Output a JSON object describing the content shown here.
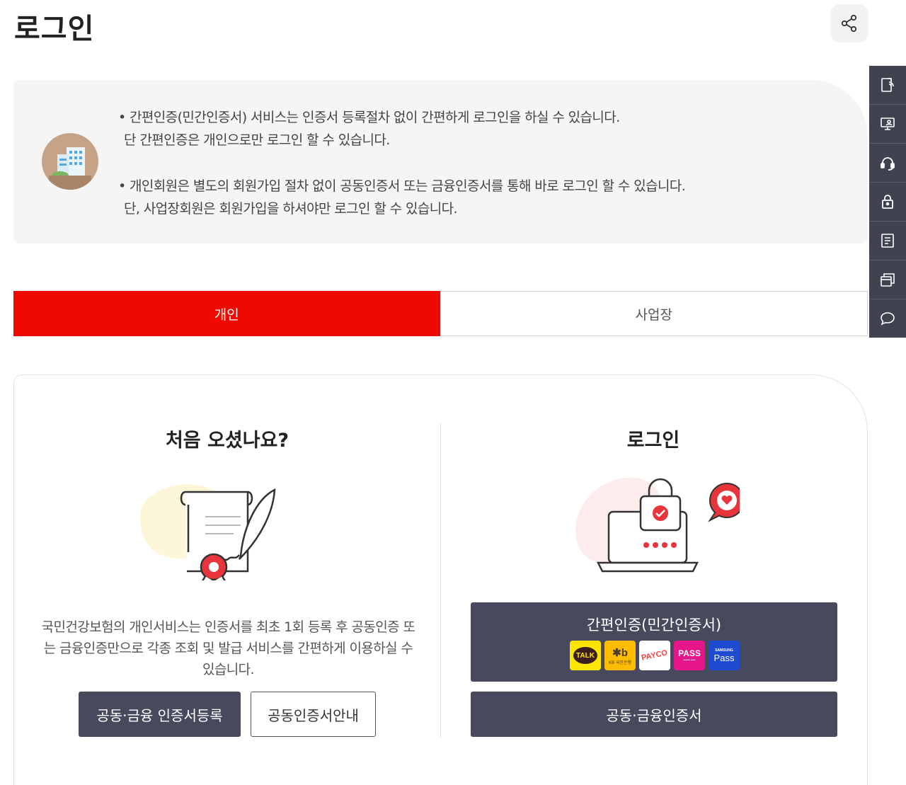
{
  "header": {
    "title": "로그인"
  },
  "notice": {
    "lines": [
      "• 간편인증(민간인증서) 서비스는 인증서 등록절차 없이 간편하게 로그인을 하실 수 있습니다.",
      "  단 간편인증은 개인으로만 로그인 할 수 있습니다.",
      "• 개인회원은 별도의 회원가입 절차 없이 공동인증서 또는 금융인증서를 통해 바로 로그인 할 수 있습니다.",
      "  단, 사업장회원은 회원가입을 하셔야만 로그인 할 수 있습니다."
    ]
  },
  "tabs": [
    {
      "label": "개인",
      "active": true
    },
    {
      "label": "사업장",
      "active": false
    }
  ],
  "left": {
    "title": "처음 오셨나요?",
    "description": "국민건강보험의 개인서비스는 인증서를 최초 1회 등록 후 공동인증 또는 금융인증만으로 각종 조회 및 발급 서비스를 간편하게 이용하실 수 있습니다.",
    "register_button": "공동·금융 인증서등록",
    "guide_button": "공동인증서안내"
  },
  "right": {
    "title": "로그인",
    "easy_auth_button": "간편인증(민간인증서)",
    "cert_button": "공동·금융인증서",
    "providers": [
      {
        "name": "kakao",
        "label": "TALK",
        "color": "#fee500"
      },
      {
        "name": "kb",
        "label": "KB 국민은행",
        "color": "#ffbc00"
      },
      {
        "name": "payco",
        "label": "PAYCO",
        "color": "#ffffff"
      },
      {
        "name": "pass",
        "label": "PASS",
        "color": "#e7158a"
      },
      {
        "name": "samsung-pass",
        "label": "SAMSUNG Pass",
        "color": "#1e4bd2"
      }
    ]
  },
  "sidebar": {
    "icons": [
      "document-icon",
      "monitor-person-icon",
      "headset-icon",
      "lock-icon",
      "notepad-icon",
      "windows-icon",
      "chat-bubble-icon"
    ]
  },
  "colors": {
    "accent": "#ee0a00",
    "button": "#464a5c",
    "sidebar": "#3f4350"
  }
}
